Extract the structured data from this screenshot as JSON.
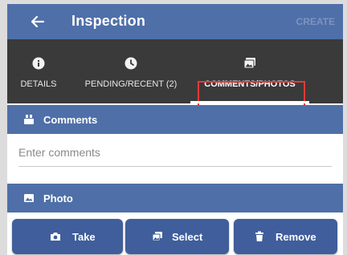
{
  "appbar": {
    "title": "Inspection",
    "action_label": "CREATE",
    "back_icon": "arrow-left-icon"
  },
  "tabs": [
    {
      "label": "DETAILS",
      "icon": "info-icon",
      "active": false
    },
    {
      "label": "PENDING/RECENT (2)",
      "icon": "clock-icon",
      "active": false
    },
    {
      "label": "COMMENTS/PHOTOS",
      "icon": "photos-icon",
      "active": true
    }
  ],
  "comments_section": {
    "title": "Comments",
    "icon": "comments-icon",
    "input_placeholder": "Enter comments",
    "input_value": ""
  },
  "photo_section": {
    "title": "Photo",
    "icon": "photo-icon"
  },
  "buttons": {
    "take": "Take",
    "select": "Select",
    "remove": "Remove"
  },
  "colors": {
    "primary": "#4f6fa8",
    "button": "#3f5e9b",
    "tabbar": "#3a3a3a",
    "highlight": "#e53935"
  }
}
